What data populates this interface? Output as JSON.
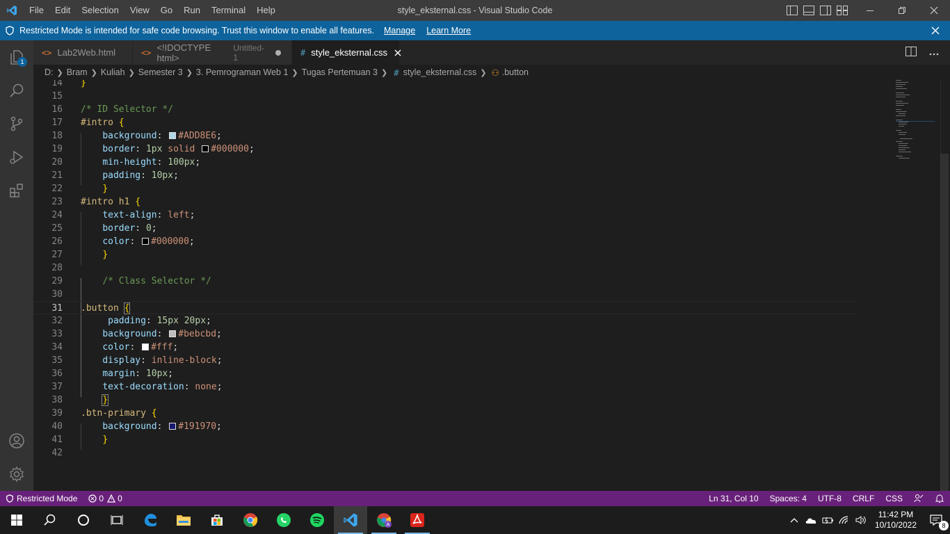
{
  "titlebar": {
    "menu": [
      "File",
      "Edit",
      "Selection",
      "View",
      "Go",
      "Run",
      "Terminal",
      "Help"
    ],
    "title": "style_eksternal.css - Visual Studio Code"
  },
  "banner": {
    "message": "Restricted Mode is intended for safe code browsing. Trust this window to enable all features.",
    "manage": "Manage",
    "learn_more": "Learn More"
  },
  "activitybar": {
    "explorer_badge": "1"
  },
  "tabs": [
    {
      "icon": "<>",
      "label": "Lab2Web.html",
      "description": ""
    },
    {
      "icon": "<>",
      "label": "<!IDOCTYPE html>",
      "description": "Untitled-1"
    },
    {
      "icon": "#",
      "label": "style_eksternal.css",
      "description": ""
    }
  ],
  "breadcrumb": [
    "D:",
    "Bram",
    "Kuliah",
    "Semester 3",
    "3. Pemrograman Web 1",
    "Tugas Pertemuan 3",
    "style_eksternal.css",
    ".button"
  ],
  "editor": {
    "line_numbers": [
      "14",
      "15",
      "16",
      "17",
      "18",
      "19",
      "20",
      "21",
      "22",
      "23",
      "24",
      "25",
      "26",
      "27",
      "28",
      "29",
      "30",
      "31",
      "32",
      "33",
      "34",
      "35",
      "36",
      "37",
      "38",
      "39",
      "40",
      "41",
      "42"
    ],
    "current_line": "31",
    "tokens": {
      "l14_brace": "}",
      "l16_comment": "/* ID Selector */",
      "l17_sel": "#intro",
      "l17_brace": "{",
      "l18_prop": "background",
      "l18_val": "#ADD8E6",
      "l19_prop": "border",
      "l19_num": "1px",
      "l19_kw": "solid",
      "l19_val": "#000000",
      "l20_prop": "min-height",
      "l20_num": "100px",
      "l21_prop": "padding",
      "l21_num": "10px",
      "l22_brace": "}",
      "l23_sel": "#intro h1",
      "l23_brace": "{",
      "l24_prop": "text-align",
      "l24_kw": "left",
      "l25_prop": "border",
      "l25_num": "0",
      "l26_prop": "color",
      "l26_val": "#000000",
      "l27_brace": "}",
      "l29_comment": "/* Class Selector */",
      "l31_sel": ".button",
      "l31_brace": "{",
      "l32_prop": "padding",
      "l32_num": "15px 20px",
      "l33_prop": "background",
      "l33_val": "#bebcbd",
      "l34_prop": "color",
      "l34_val": "#fff",
      "l35_prop": "display",
      "l35_kw": "inline-block",
      "l36_prop": "margin",
      "l36_num": "10px",
      "l37_prop": "text-decoration",
      "l37_kw": "none",
      "l38_brace": "}",
      "l39_sel": ".btn-primary",
      "l39_brace": "{",
      "l40_prop": "background",
      "l40_val": "#191970",
      "l41_brace": "}"
    },
    "swatches": {
      "l18": "#ADD8E6",
      "l19": "#000000",
      "l26": "#000000",
      "l33": "#bebcbd",
      "l34": "#ffffff",
      "l40": "#191970"
    }
  },
  "statusbar": {
    "restricted": "Restricted Mode",
    "errors": "0",
    "warnings": "0",
    "position": "Ln 31, Col 10",
    "spaces": "Spaces: 4",
    "encoding": "UTF-8",
    "eol": "CRLF",
    "language": "CSS"
  },
  "taskbar": {
    "time": "11:42 PM",
    "date": "10/10/2022",
    "notification_count": "8"
  },
  "colors": {
    "banner": "#0e639c",
    "statusbar": "#68217a",
    "titlebar": "#3c3c3c",
    "editor_bg": "#1e1e1e"
  }
}
